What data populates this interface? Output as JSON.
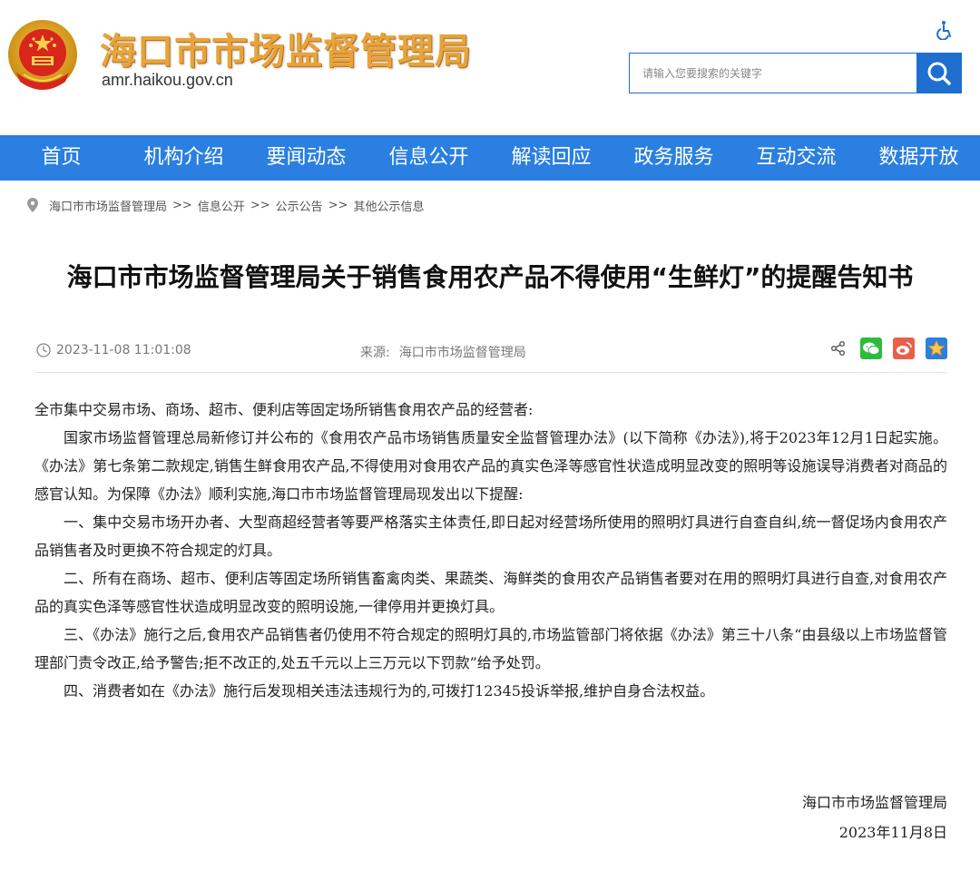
{
  "header": {
    "site_title": "海口市市场监督管理局",
    "site_domain": "amr.haikou.gov.cn",
    "search_placeholder": "请输入您要搜索的关键字",
    "colors": {
      "brand_blue": "#1e6fd0",
      "title_gold": "#e8a33a"
    }
  },
  "nav": {
    "items": [
      "首页",
      "机构介绍",
      "要闻动态",
      "信息公开",
      "解读回应",
      "政务服务",
      "互动交流",
      "数据开放"
    ]
  },
  "breadcrumb": {
    "items": [
      "海口市市场监督管理局",
      "信息公开",
      "公示公告",
      "其他公示信息"
    ],
    "separator": ">>"
  },
  "article": {
    "title": "海口市市场监督管理局关于销售食用农产品不得使用“生鲜灯”的提醒告知书",
    "date": "2023-11-08 11:01:08",
    "source_label": "来源:",
    "source_value": "海口市市场监督管理局",
    "greeting": "全市集中交易市场、商场、超市、便利店等固定场所销售食用农产品的经营者:",
    "paragraphs": [
      "国家市场监督管理总局新修订并公布的《食用农产品市场销售质量安全监督管理办法》(以下简称《办法》),将于2023年12月1日起实施。《办法》第七条第二款规定,销售生鲜食用农产品,不得使用对食用农产品的真实色泽等感官性状造成明显改变的照明等设施误导消费者对商品的感官认知。为保障《办法》顺利实施,海口市市场监督管理局现发出以下提醒:",
      "一、集中交易市场开办者、大型商超经营者等要严格落实主体责任,即日起对经营场所使用的照明灯具进行自查自纠,统一督促场内食用农产品销售者及时更换不符合规定的灯具。",
      "二、所有在商场、超市、便利店等固定场所销售畜禽肉类、果蔬类、海鲜类的食用农产品销售者要对在用的照明灯具进行自查,对食用农产品的真实色泽等感官性状造成明显改变的照明设施,一律停用并更换灯具。",
      "三、《办法》施行之后,食用农产品销售者仍使用不符合规定的照明灯具的,市场监管部门将依据《办法》第三十八条“由县级以上市场监督管理部门责令改正,给予警告;拒不改正的,处五千元以上三万元以下罚款”给予处罚。",
      "四、消费者如在《办法》施行后发现相关违法违规行为的,可拨打12345投诉举报,维护自身合法权益。"
    ],
    "signature_org": "海口市市场监督管理局",
    "signature_date": "2023年11月8日"
  },
  "share": {
    "icons": [
      "share-icon",
      "wechat-icon",
      "weibo-icon",
      "favorite-icon"
    ],
    "colors": {
      "wechat": "#2dbb3e",
      "weibo": "#e8604a",
      "favorite": "#2a7fe0"
    }
  }
}
